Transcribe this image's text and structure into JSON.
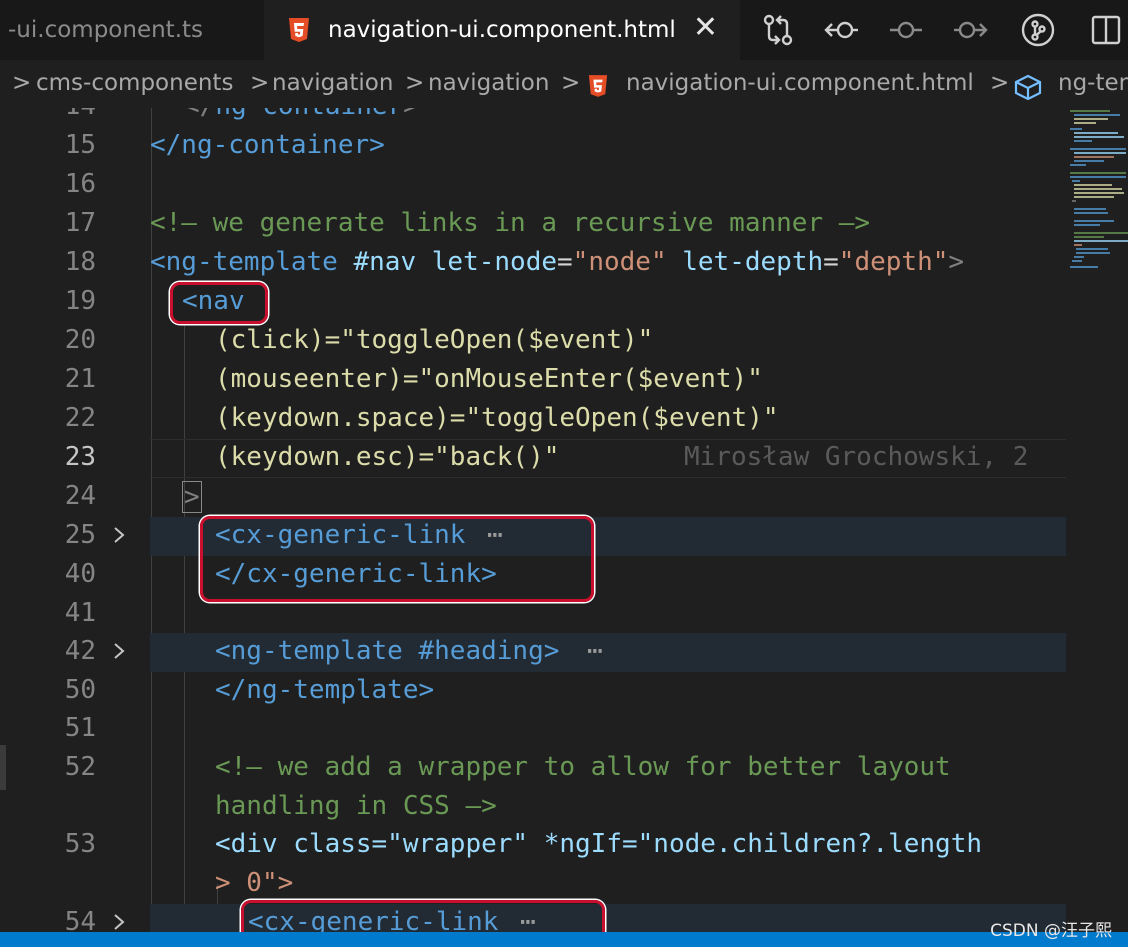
{
  "tabs": {
    "inactive_label": "-ui.component.ts",
    "active_label": "navigation-ui.component.html",
    "close_glyph": "✕"
  },
  "breadcrumb": {
    "items": [
      "cms-components",
      "navigation",
      "navigation",
      "navigation-ui.component.html",
      "ng-ten"
    ],
    "separator": ">"
  },
  "editor": {
    "lines": [
      {
        "n": "14"
      },
      {
        "n": "15",
        "t": "</ng-container>"
      },
      {
        "n": "16"
      },
      {
        "n": "17",
        "t": "<!— we generate links in a recursive manner —>"
      },
      {
        "n": "18",
        "a": "<ng-template",
        "b": "#nav",
        "c": "let-node",
        "d": "=",
        "e": "\"node\"",
        "f": "let-depth",
        "g": "=",
        "h": "\"depth\"",
        "i": ">"
      },
      {
        "n": "19",
        "t": "<nav"
      },
      {
        "n": "20",
        "t": "(click)=\"toggleOpen($event)\""
      },
      {
        "n": "21",
        "t": "(mouseenter)=\"onMouseEnter($event)\""
      },
      {
        "n": "22",
        "t": "(keydown.space)=\"toggleOpen($event)\""
      },
      {
        "n": "23",
        "t": "(keydown.esc)=\"back()\"",
        "blame": "Mirosław Grochowski, 2"
      },
      {
        "n": "24",
        "t": ">"
      },
      {
        "n": "25",
        "t": "<cx-generic-link",
        "ellipsis": "⋯"
      },
      {
        "n": "40",
        "t": "</cx-generic-link>"
      },
      {
        "n": "41"
      },
      {
        "n": "42",
        "t": "<ng-template #heading>",
        "ellipsis": "⋯"
      },
      {
        "n": "50",
        "t": "</ng-template>"
      },
      {
        "n": "51"
      },
      {
        "n": "52",
        "t": "<!— we add a wrapper to allow for better layout",
        "t2": "handling in CSS —>"
      },
      {
        "n": "53",
        "t": "<div class=\"wrapper\" *ngIf=\"node.children?.length",
        "t2": "> 0\">"
      },
      {
        "n": "54",
        "t": "<cx-generic-link",
        "ellipsis": "⋯"
      }
    ]
  },
  "watermark": "CSDN @汪子熙",
  "colors": {
    "editor_bg": "#1f1f1f",
    "highlight_row": "#222a33",
    "annotation_red": "#c8102e",
    "status_bar": "#007acc"
  },
  "icons": [
    "html5-icon",
    "git-compare-icon",
    "go-back-icon",
    "timeline-icon",
    "go-forward-icon",
    "git-graph-icon",
    "split-editor-icon",
    "cube-icon",
    "chevron-right-icon"
  ]
}
